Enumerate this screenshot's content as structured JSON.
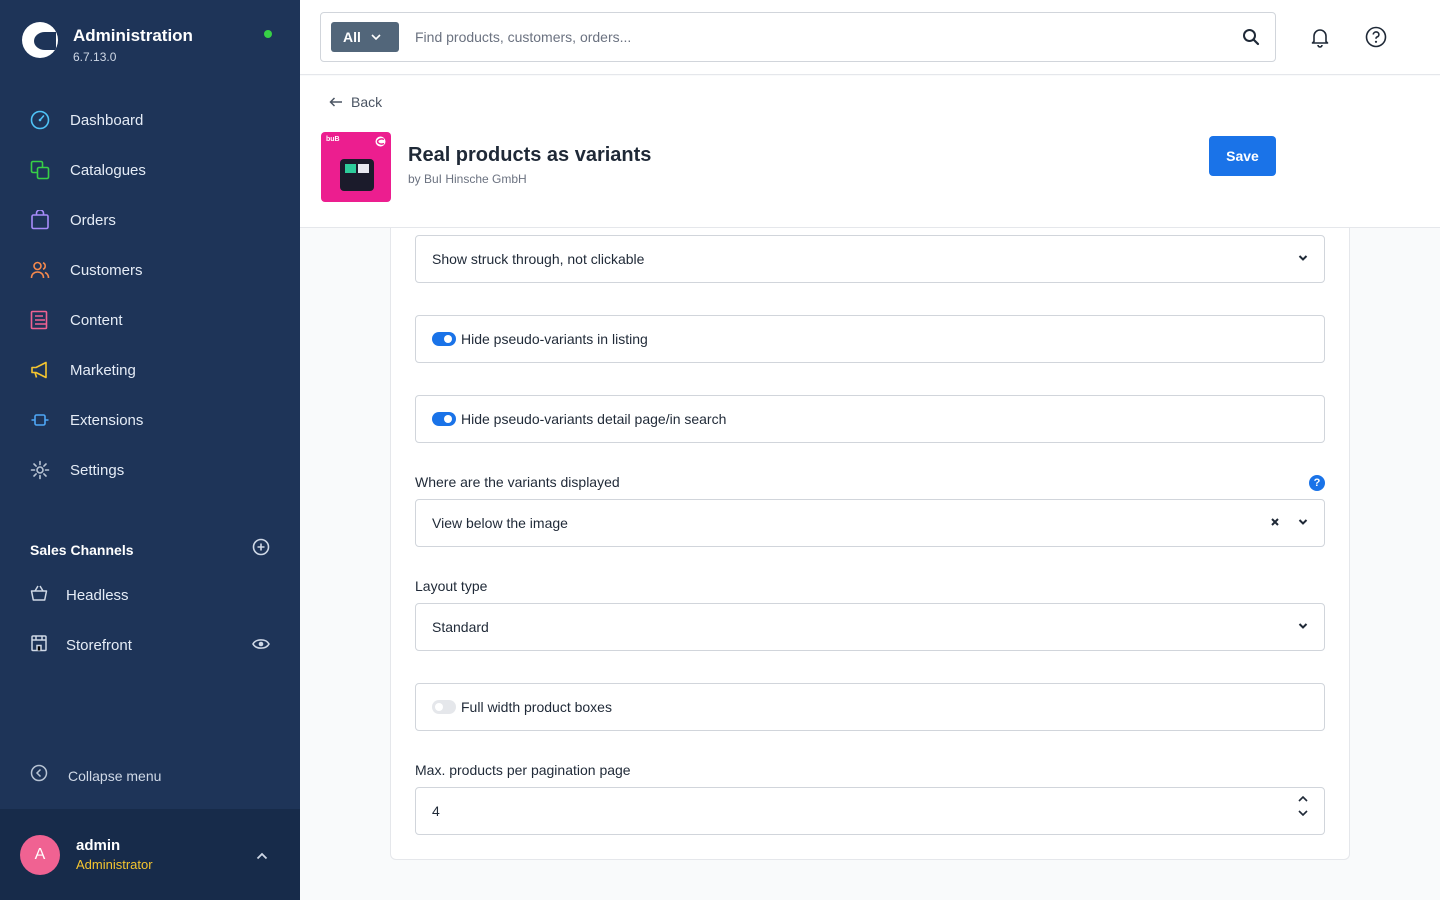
{
  "app": {
    "title": "Administration",
    "version": "6.7.13.0"
  },
  "sidebar": {
    "items": [
      {
        "label": "Dashboard",
        "icon": "dashboard-icon"
      },
      {
        "label": "Catalogues",
        "icon": "catalogues-icon"
      },
      {
        "label": "Orders",
        "icon": "orders-icon"
      },
      {
        "label": "Customers",
        "icon": "customers-icon"
      },
      {
        "label": "Content",
        "icon": "content-icon"
      },
      {
        "label": "Marketing",
        "icon": "marketing-icon"
      },
      {
        "label": "Extensions",
        "icon": "extensions-icon"
      },
      {
        "label": "Settings",
        "icon": "settings-icon"
      }
    ],
    "sales_channels": {
      "title": "Sales Channels",
      "items": [
        {
          "label": "Headless"
        },
        {
          "label": "Storefront"
        }
      ]
    },
    "collapse_label": "Collapse menu",
    "user": {
      "initial": "A",
      "name": "admin",
      "role": "Administrator"
    }
  },
  "search": {
    "scope": "All",
    "placeholder": "Find products, customers, orders..."
  },
  "header": {
    "back_label": "Back",
    "plugin_title": "Real products as variants",
    "plugin_author": "by BuI Hinsche GmbH",
    "plugin_icon_text": "buB",
    "save_label": "Save"
  },
  "form": {
    "unavailable_variants_value": "Show struck through, not clickable",
    "hide_in_listing": {
      "label": "Hide pseudo-variants in listing",
      "checked": true
    },
    "hide_in_detail": {
      "label": "Hide pseudo-variants detail page/in search",
      "checked": true
    },
    "display_position": {
      "label": "Where are the variants displayed",
      "value": "View below the image",
      "help": "?"
    },
    "layout_type": {
      "label": "Layout type",
      "value": "Standard"
    },
    "full_width": {
      "label": "Full width product boxes",
      "checked": false
    },
    "max_products": {
      "label": "Max. products per pagination page",
      "value": "4"
    }
  },
  "colors": {
    "sidebar_bg": "#1e3458",
    "primary": "#1a73e8",
    "status_online": "#37d046",
    "plugin_brand": "#ec1e8f"
  }
}
